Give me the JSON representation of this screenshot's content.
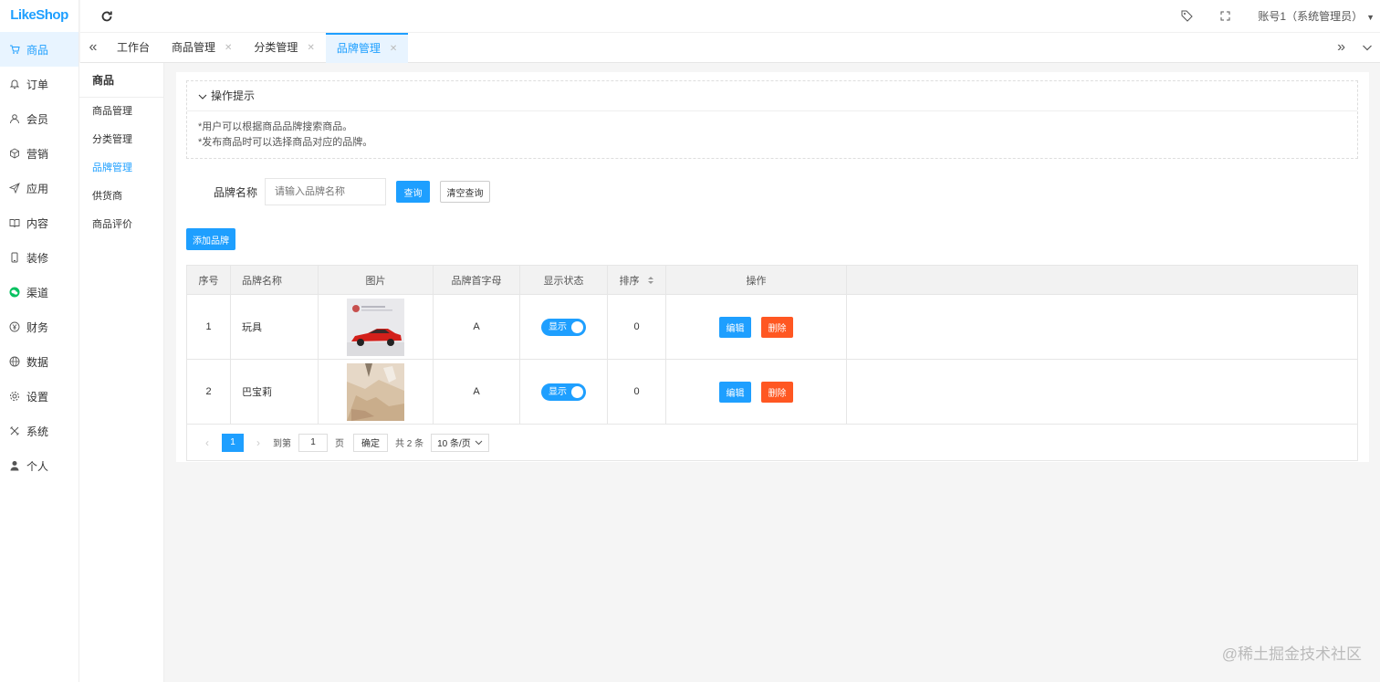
{
  "app": {
    "logo": "LikeShop"
  },
  "sidebar": {
    "items": [
      {
        "label": "商品",
        "icon": "cart-icon"
      },
      {
        "label": "订单",
        "icon": "bell-icon"
      },
      {
        "label": "会员",
        "icon": "user-icon"
      },
      {
        "label": "营销",
        "icon": "cube-icon"
      },
      {
        "label": "应用",
        "icon": "send-icon"
      },
      {
        "label": "内容",
        "icon": "book-icon"
      },
      {
        "label": "装修",
        "icon": "phone-icon"
      },
      {
        "label": "渠道",
        "icon": "wechat-icon"
      },
      {
        "label": "财务",
        "icon": "yen-icon"
      },
      {
        "label": "数据",
        "icon": "globe-icon"
      },
      {
        "label": "设置",
        "icon": "gear-icon"
      },
      {
        "label": "系统",
        "icon": "tools-icon"
      },
      {
        "label": "个人",
        "icon": "person-icon"
      }
    ]
  },
  "submenu": {
    "title": "商品",
    "items": [
      "商品管理",
      "分类管理",
      "品牌管理",
      "供货商",
      "商品评价"
    ]
  },
  "topbar": {
    "account": "账号1（系统管理员）"
  },
  "tabs": [
    {
      "label": "工作台"
    },
    {
      "label": "商品管理"
    },
    {
      "label": "分类管理"
    },
    {
      "label": "品牌管理"
    }
  ],
  "tips": {
    "title": "操作提示",
    "lines": [
      "*用户可以根据商品品牌搜索商品。",
      "*发布商品时可以选择商品对应的品牌。"
    ]
  },
  "search": {
    "label": "品牌名称",
    "placeholder": "请输入品牌名称",
    "query_btn": "查询",
    "clear_btn": "清空查询"
  },
  "actions": {
    "add_btn": "添加品牌"
  },
  "table": {
    "headers": [
      "序号",
      "品牌名称",
      "图片",
      "品牌首字母",
      "显示状态",
      "排序",
      "操作"
    ],
    "rows": [
      {
        "index": "1",
        "name": "玩具",
        "initial": "A",
        "status": "显示",
        "sort": "0",
        "edit": "编辑",
        "delete": "删除"
      },
      {
        "index": "2",
        "name": "巴宝莉",
        "initial": "A",
        "status": "显示",
        "sort": "0",
        "edit": "编辑",
        "delete": "删除"
      }
    ]
  },
  "pager": {
    "current": "1",
    "goto": "到第",
    "page_value": "1",
    "page_unit": "页",
    "confirm": "确定",
    "total": "共 2 条",
    "size": "10 条/页"
  },
  "watermark": "@稀土掘金技术社区",
  "colors": {
    "primary": "#1E9FFF",
    "danger": "#FF5722"
  }
}
